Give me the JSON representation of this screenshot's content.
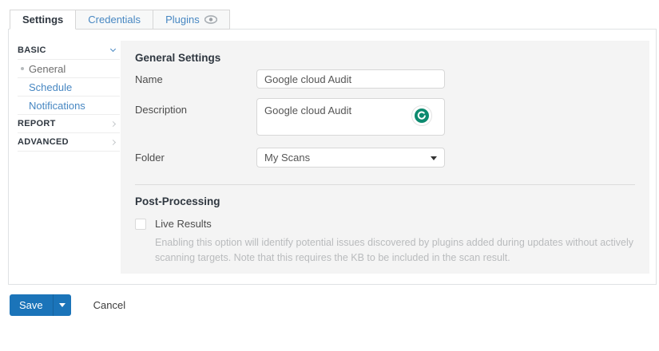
{
  "tabs": [
    {
      "label": "Settings",
      "active": true
    },
    {
      "label": "Credentials",
      "active": false
    },
    {
      "label": "Plugins",
      "active": false,
      "icon": "eye-icon"
    }
  ],
  "sidebar": {
    "sections": [
      {
        "label": "BASIC",
        "state": "expanded"
      },
      {
        "label": "REPORT",
        "state": "collapsed"
      },
      {
        "label": "ADVANCED",
        "state": "collapsed"
      }
    ],
    "basic_items": [
      {
        "label": "General",
        "selected": true
      },
      {
        "label": "Schedule",
        "selected": false
      },
      {
        "label": "Notifications",
        "selected": false
      }
    ]
  },
  "general_settings": {
    "title": "General Settings",
    "name_label": "Name",
    "name_value": "Google cloud Audit",
    "description_label": "Description",
    "description_value": "Google cloud Audit",
    "folder_label": "Folder",
    "folder_value": "My Scans"
  },
  "post_processing": {
    "title": "Post-Processing",
    "live_results_label": "Live Results",
    "live_results_checked": false,
    "live_results_help": "Enabling this option will identify potential issues discovered by plugins added during updates without actively scanning targets. Note that this requires the KB to be included in the scan result."
  },
  "footer": {
    "save_label": "Save",
    "cancel_label": "Cancel"
  },
  "colors": {
    "accent_blue": "#1b74b9",
    "link_blue": "#4787c2",
    "panel_gray": "#f4f4f4",
    "grammarly_teal": "#0d8a6f"
  }
}
